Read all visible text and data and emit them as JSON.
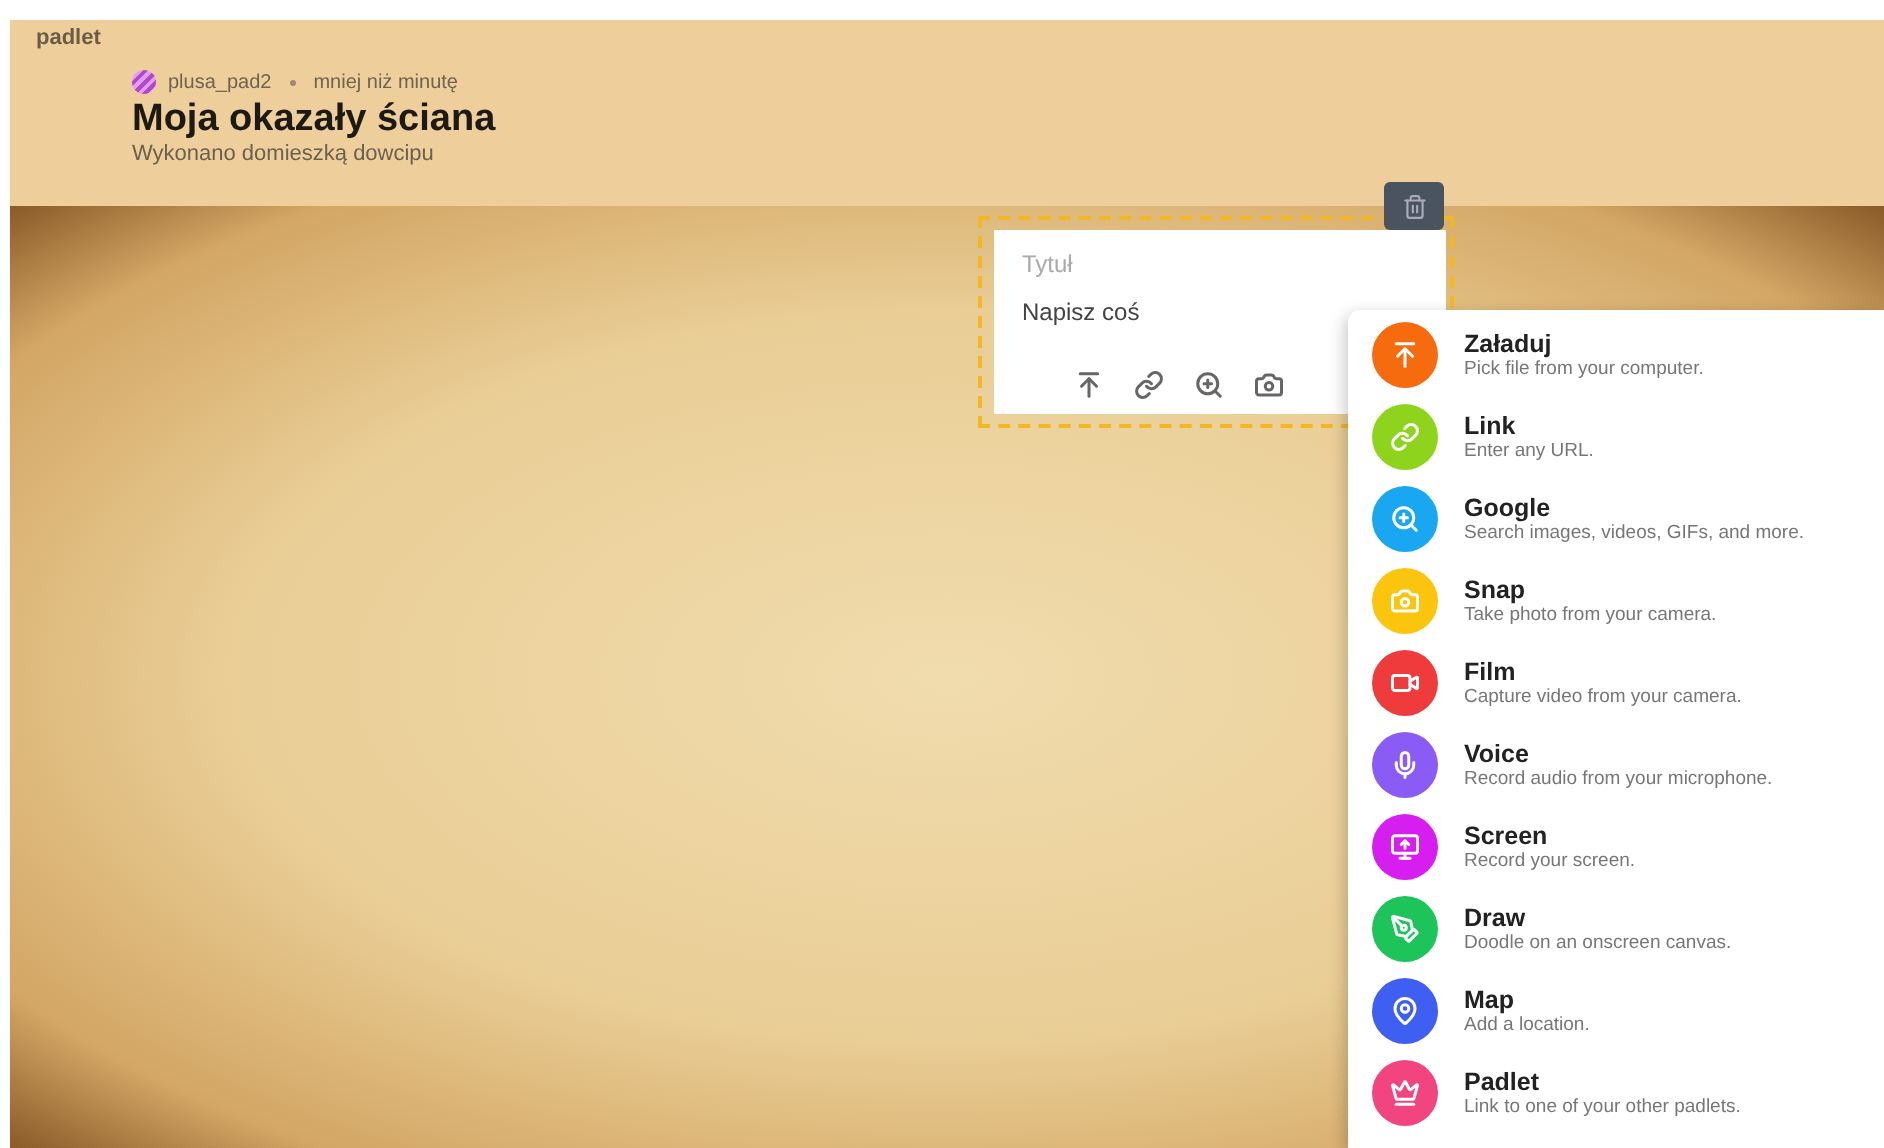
{
  "brand": "padlet",
  "header": {
    "author": "plusa_pad2",
    "time": "mniej niż minutę",
    "title": "Moja okazały ściana",
    "subtitle": "Wykonano domieszką dowcipu"
  },
  "post": {
    "title_placeholder": "Tytuł",
    "body_placeholder": "Napisz coś",
    "tools": [
      {
        "kind": "upload"
      },
      {
        "kind": "link"
      },
      {
        "kind": "search"
      },
      {
        "kind": "camera"
      }
    ]
  },
  "attach_menu": [
    {
      "kind": "upload",
      "color": "#f76b0f",
      "label": "Załaduj",
      "description": "Pick file from your computer."
    },
    {
      "kind": "link",
      "color": "#8fd41c",
      "label": "Link",
      "description": "Enter any URL."
    },
    {
      "kind": "search",
      "color": "#1aa7f2",
      "label": "Google",
      "description": "Search images, videos, GIFs, and more."
    },
    {
      "kind": "camera",
      "color": "#fcc50d",
      "label": "Snap",
      "description": "Take photo from your camera."
    },
    {
      "kind": "video",
      "color": "#ef3b3b",
      "label": "Film",
      "description": "Capture video from your camera."
    },
    {
      "kind": "mic",
      "color": "#8a5cf5",
      "label": "Voice",
      "description": "Record audio from your microphone."
    },
    {
      "kind": "screen",
      "color": "#d61ef0",
      "label": "Screen",
      "description": "Record your screen."
    },
    {
      "kind": "draw",
      "color": "#1cc45a",
      "label": "Draw",
      "description": "Doodle on an onscreen canvas."
    },
    {
      "kind": "map",
      "color": "#3f5ef2",
      "label": "Map",
      "description": "Add a location."
    },
    {
      "kind": "padlet",
      "color": "#f2457f",
      "label": "Padlet",
      "description": "Link to one of your other padlets."
    }
  ]
}
